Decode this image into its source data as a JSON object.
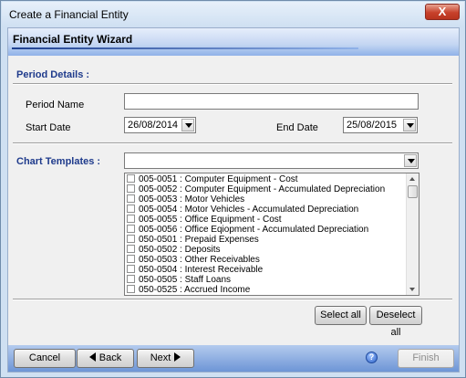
{
  "window": {
    "title": "Create a Financial Entity",
    "close_label": "X"
  },
  "wizard": {
    "header_title": "Financial Entity Wizard"
  },
  "period": {
    "section_label": "Period Details :",
    "name_label": "Period Name",
    "name_value": "",
    "start_label": "Start Date",
    "start_value": "26/08/2014",
    "end_label": "End Date",
    "end_value": "25/08/2015"
  },
  "chart_templates": {
    "section_label": "Chart Templates :",
    "selected_value": "",
    "items": [
      {
        "label": "005-0051 : Computer Equipment - Cost"
      },
      {
        "label": "005-0052 : Computer Equipment - Accumulated Depreciation"
      },
      {
        "label": "005-0053 : Motor Vehicles"
      },
      {
        "label": "005-0054 : Motor Vehicles - Accumulated Depreciation"
      },
      {
        "label": "005-0055 : Office Equipment - Cost"
      },
      {
        "label": "005-0056 : Office Eqiopment - Accumulated Depreciation"
      },
      {
        "label": "050-0501 : Prepaid Expenses"
      },
      {
        "label": "050-0502 : Deposits"
      },
      {
        "label": "050-0503 : Other Receivables"
      },
      {
        "label": "050-0504 : Interest Receivable"
      },
      {
        "label": "050-0505 : Staff Loans"
      },
      {
        "label": "050-0525 : Accrued Income"
      }
    ]
  },
  "actions": {
    "select_all": "Select all",
    "deselect_all": "Deselect all"
  },
  "footer": {
    "cancel": "Cancel",
    "back": "Back",
    "next": "Next",
    "help": "?",
    "finish": "Finish"
  }
}
